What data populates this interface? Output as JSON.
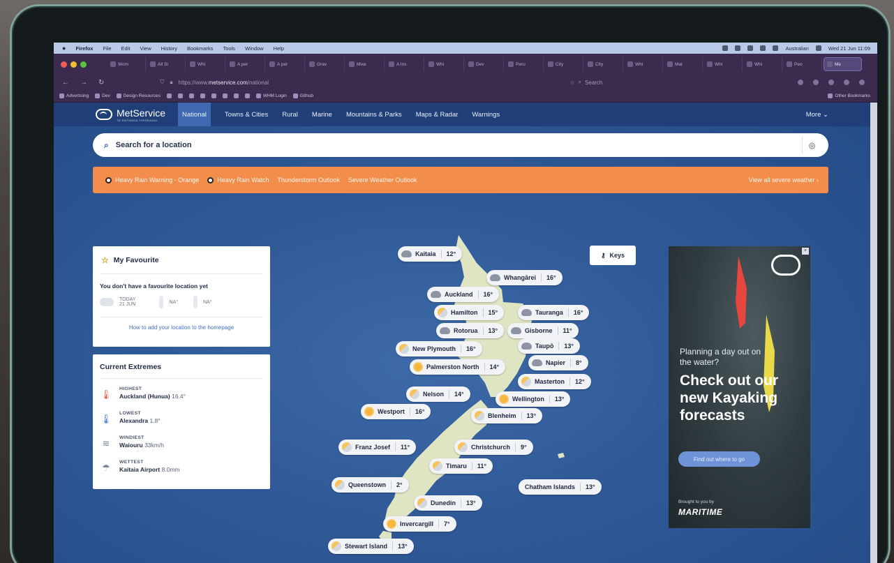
{
  "macbar": {
    "app": "Firefox",
    "menus": [
      "File",
      "Edit",
      "View",
      "History",
      "Bookmarks",
      "Tools",
      "Window",
      "Help"
    ],
    "input_source": "Australian",
    "datetime": "Wed 21 Jun 11:09"
  },
  "tabs": [
    "Wom",
    "All Si",
    "Whi",
    "A per",
    "A per",
    "Grav",
    "Mixe",
    "A Ins",
    "Whi",
    "Dev",
    "Peru",
    "City",
    "City",
    "Whi",
    "Mat",
    "Whi",
    "Whi",
    "Peo",
    "Me"
  ],
  "url": {
    "prefix": "https://www.",
    "host": "metservice.com",
    "path": "/national",
    "search_placeholder": "Search"
  },
  "bookmarks": {
    "items": [
      "Advertising",
      "Dev",
      "Design Resources",
      "WHM Login",
      "Github"
    ],
    "other": "Other Bookmarks"
  },
  "site": {
    "logo": "MetService",
    "logo_sub": "TE RATONGA TIRORANGI",
    "nav": [
      "National",
      "Towns & Cities",
      "Rural",
      "Marine",
      "Mountains & Parks",
      "Maps & Radar",
      "Warnings"
    ],
    "more": "More"
  },
  "search": {
    "placeholder": "Search for a location"
  },
  "warnings": {
    "items": [
      "Heavy Rain Warning - Orange",
      "Heavy Rain Watch",
      "Thunderstorm Outlook",
      "Severe Weather Outlook"
    ],
    "view_all": "View all severe weather"
  },
  "favourite": {
    "title": "My Favourite",
    "message": "You don't have a favourite location yet",
    "day": "TODAY",
    "date": "21 JUN",
    "high": "NA°",
    "low": "NA°",
    "link": "How to add your location to the homepage"
  },
  "extremes": {
    "title": "Current Extremes",
    "items": [
      {
        "label": "HIGHEST",
        "place": "Auckland (Hunua)",
        "value": "16.4°"
      },
      {
        "label": "LOWEST",
        "place": "Alexandra",
        "value": "1.8°"
      },
      {
        "label": "WINDIEST",
        "place": "Waiouru",
        "value": "33km/h"
      },
      {
        "label": "WETTEST",
        "place": "Kaitaia Airport",
        "value": "8.0mm"
      }
    ]
  },
  "keys": "Keys",
  "cities": [
    {
      "name": "Kaitaia",
      "temp": "12°",
      "icon": "cloud"
    },
    {
      "name": "Whangārei",
      "temp": "16°",
      "icon": "cloud"
    },
    {
      "name": "Auckland",
      "temp": "16°",
      "icon": "cloud"
    },
    {
      "name": "Hamilton",
      "temp": "15°",
      "icon": "pc"
    },
    {
      "name": "Tauranga",
      "temp": "16°",
      "icon": "cloud"
    },
    {
      "name": "Rotorua",
      "temp": "13°",
      "icon": "cloud"
    },
    {
      "name": "Gisborne",
      "temp": "11°",
      "icon": "cloud"
    },
    {
      "name": "New Plymouth",
      "temp": "16°",
      "icon": "pc"
    },
    {
      "name": "Taupō",
      "temp": "13°",
      "icon": "cloud"
    },
    {
      "name": "Palmerston North",
      "temp": "14°",
      "icon": "sun"
    },
    {
      "name": "Napier",
      "temp": "8°",
      "icon": "cloud"
    },
    {
      "name": "Masterton",
      "temp": "12°",
      "icon": "pc"
    },
    {
      "name": "Nelson",
      "temp": "14°",
      "icon": "pc"
    },
    {
      "name": "Wellington",
      "temp": "13°",
      "icon": "sun"
    },
    {
      "name": "Westport",
      "temp": "16°",
      "icon": "sun"
    },
    {
      "name": "Blenheim",
      "temp": "13°",
      "icon": "pc"
    },
    {
      "name": "Franz Josef",
      "temp": "11°",
      "icon": "pc"
    },
    {
      "name": "Christchurch",
      "temp": "9°",
      "icon": "pc"
    },
    {
      "name": "Timaru",
      "temp": "11°",
      "icon": "pc"
    },
    {
      "name": "Queenstown",
      "temp": "2°",
      "icon": "pc"
    },
    {
      "name": "Chatham Islands",
      "temp": "13°",
      "icon": "none"
    },
    {
      "name": "Dunedin",
      "temp": "13°",
      "icon": "pc"
    },
    {
      "name": "Invercargill",
      "temp": "7°",
      "icon": "sun"
    },
    {
      "name": "Stewart Island",
      "temp": "13°",
      "icon": "pc"
    }
  ],
  "ad": {
    "tagline": "Planning a day out on the water?",
    "headline": "Check out our new Kayaking forecasts",
    "cta": "Find out where to go",
    "brought": "Brought to you by",
    "sponsor": "MARITIME"
  },
  "colors": {
    "warning": "#f28d4c",
    "nav": "#203f78",
    "page_bg": "#2f5996",
    "tab_bg": "#3a2b4f"
  }
}
